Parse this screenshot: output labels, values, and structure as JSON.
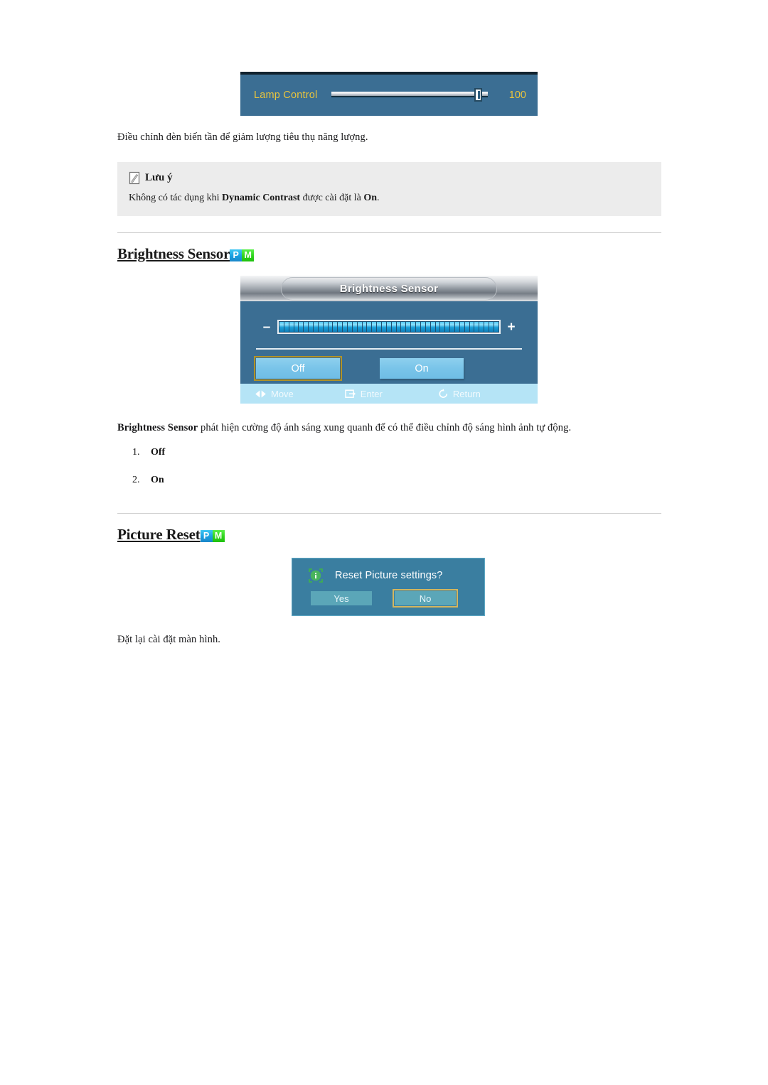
{
  "lamp_osd": {
    "label": "Lamp Control",
    "value": "100",
    "slider_percent": 100
  },
  "lamp_caption": "Điều chỉnh đèn biến tần để giảm lượng tiêu thụ năng lượng.",
  "note": {
    "icon": "note-pencil-icon",
    "title": "Lưu ý",
    "body_prefix": "Không có tác dụng khi ",
    "body_bold": "Dynamic Contrast",
    "body_middle": " được cài đặt là ",
    "body_bold2": "On",
    "body_suffix": "."
  },
  "sections": [
    {
      "heading": "Brightness Sensor ",
      "badges": [
        "P",
        "M"
      ]
    },
    {
      "heading": "Picture Reset",
      "badges": [
        "P",
        "M"
      ]
    }
  ],
  "brightness_osd": {
    "title": "Brightness Sensor",
    "minus_sign": "–",
    "plus_sign": "+",
    "bar_segments": 45,
    "bar_filled": 45,
    "buttons": [
      {
        "label": "Off",
        "selected": true
      },
      {
        "label": "On",
        "selected": false
      }
    ],
    "footer": [
      {
        "icon": "move-left-right-icon",
        "label": "Move"
      },
      {
        "icon": "enter-key-icon",
        "label": "Enter"
      },
      {
        "icon": "return-arrow-icon",
        "label": "Return"
      }
    ]
  },
  "brightness_caption": {
    "bold": "Brightness Sensor",
    "rest": " phát hiện cường độ ánh sáng xung quanh để có thể điều chỉnh độ sáng hình ảnh tự động."
  },
  "brightness_list": [
    {
      "num": "1.",
      "label": "Off"
    },
    {
      "num": "2.",
      "label": "On"
    }
  ],
  "reset_dialog": {
    "icon": "info-circle-icon",
    "message": "Reset Picture settings?",
    "buttons": [
      {
        "label": "Yes",
        "selected": false
      },
      {
        "label": "No",
        "selected": true
      }
    ]
  },
  "reset_caption": "Đặt lại cài đặt màn hình.",
  "colors": {
    "osd_background": "#3b6e93",
    "osd_accent_text": "#e9c43c",
    "badge_p": "#189fe0",
    "badge_m": "#2ed31c",
    "selection_border": "#b29327",
    "note_background": "#ececec",
    "footer_background": "#b5e4f6"
  }
}
